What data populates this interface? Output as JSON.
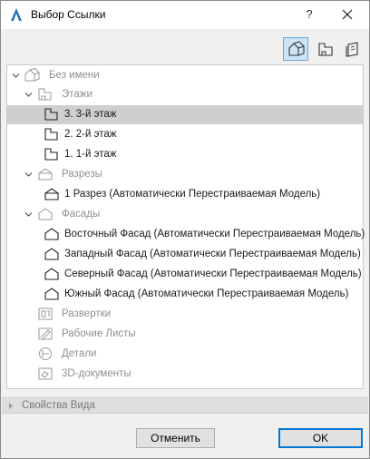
{
  "window": {
    "title": "Выбор Ссылки",
    "help_glyph": "?"
  },
  "toolbar": {
    "buttons": [
      {
        "icon": "project-map-icon",
        "active": true
      },
      {
        "icon": "view-map-icon",
        "active": false
      },
      {
        "icon": "layout-book-icon",
        "active": false
      }
    ]
  },
  "tree": {
    "items": [
      {
        "label": "Без имени",
        "icon": "project-house-icon",
        "expanded": true,
        "dim": true
      },
      {
        "label": "Этажи",
        "icon": "stories-icon",
        "expanded": true,
        "dim": true
      },
      {
        "label": "3. 3-й этаж",
        "icon": "story-icon",
        "selected": true
      },
      {
        "label": "2. 2-й этаж",
        "icon": "story-icon"
      },
      {
        "label": "1. 1-й этаж",
        "icon": "story-icon"
      },
      {
        "label": "Разрезы",
        "icon": "sections-icon",
        "expanded": true,
        "dim": true
      },
      {
        "label": "1 Разрез (Автоматически Перестраиваемая Модель)",
        "icon": "section-icon"
      },
      {
        "label": "Фасады",
        "icon": "elevations-icon",
        "expanded": true,
        "dim": true
      },
      {
        "label": "Восточный Фасад (Автоматически Перестраиваемая Модель)",
        "icon": "elevation-icon"
      },
      {
        "label": "Западный Фасад (Автоматически Перестраиваемая Модель)",
        "icon": "elevation-icon"
      },
      {
        "label": "Северный Фасад (Автоматически Перестраиваемая Модель)",
        "icon": "elevation-icon"
      },
      {
        "label": "Южный Фасад (Автоматически Перестраиваемая Модель)",
        "icon": "elevation-icon"
      },
      {
        "label": "Развертки",
        "icon": "interior-elevations-icon",
        "dim": true
      },
      {
        "label": "Рабочие Листы",
        "icon": "worksheets-icon",
        "dim": true
      },
      {
        "label": "Детали",
        "icon": "details-icon",
        "dim": true
      },
      {
        "label": "3D-документы",
        "icon": "3d-documents-icon",
        "dim": true
      }
    ]
  },
  "properties": {
    "label": "Свойства Вида",
    "expanded": false
  },
  "footer": {
    "cancel_label": "Отменить",
    "ok_label": "OK"
  },
  "colors": {
    "selection": "#cfcfcf",
    "active_tool": "#cfe3f7",
    "ok_border": "#0078d7"
  }
}
